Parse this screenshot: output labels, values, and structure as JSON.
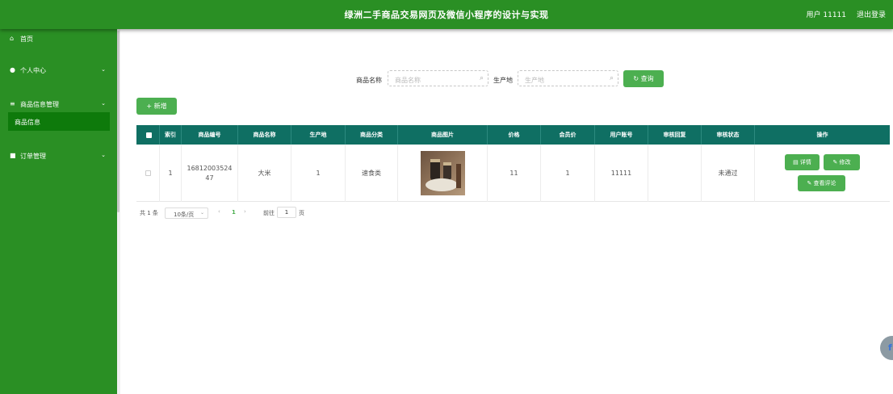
{
  "header": {
    "title": "绿洲二手商品交易网页及微信小程序的设计与实现",
    "user": "用户 11111",
    "logout": "退出登录"
  },
  "sidebar": {
    "items": [
      {
        "label": "首页",
        "icon": "home-icon"
      },
      {
        "label": "个人中心",
        "icon": "user-icon"
      },
      {
        "label": "商品信息管理",
        "icon": "menu-icon"
      },
      {
        "label": "订单管理",
        "icon": "order-icon"
      }
    ],
    "active_sub": "商品信息"
  },
  "search": {
    "name_label": "商品名称",
    "name_placeholder": "商品名称",
    "origin_label": "生产地",
    "origin_placeholder": "生产地",
    "query_button": "查询"
  },
  "toolbar": {
    "add_button": "+ 新增"
  },
  "table": {
    "headers": [
      "索引",
      "商品编号",
      "商品名称",
      "生产地",
      "商品分类",
      "商品图片",
      "价格",
      "会员价",
      "用户账号",
      "审核回复",
      "审核状态",
      "操作"
    ],
    "rows": [
      {
        "index": "1",
        "code": "1681200352447",
        "name": "大米",
        "origin": "1",
        "category": "速食类",
        "price": "11",
        "vip_price": "1",
        "account": "11111",
        "reply": "",
        "status": "未通过"
      }
    ],
    "actions": {
      "detail": "详情",
      "edit": "修改",
      "reviews": "查看评论"
    }
  },
  "pager": {
    "total": "共 1 条",
    "page_size": "10条/页",
    "current": "1",
    "goto_label": "前往",
    "goto_value": "1",
    "page_suffix": "页"
  },
  "colors": {
    "brand": "#2a8f24",
    "table_header": "#0f6f63",
    "button": "#4caf50"
  }
}
